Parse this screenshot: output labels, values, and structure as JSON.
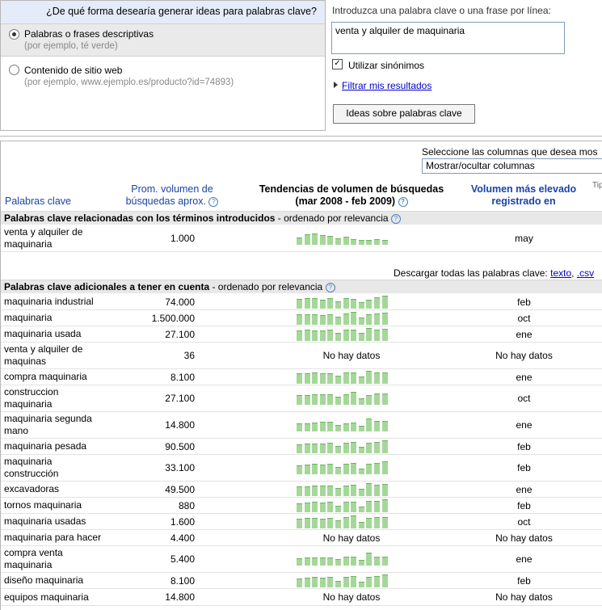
{
  "question": "¿De qué forma desearía generar ideas para palabras clave?",
  "options": [
    {
      "label": "Palabras o frases descriptivas",
      "hint": "(por ejemplo, té verde)",
      "selected": true
    },
    {
      "label": "Contenido de sitio web",
      "hint": "(por ejemplo, www.ejemplo.es/producto?id=74893)",
      "selected": false
    }
  ],
  "keyword_entry": {
    "heading": "Introduzca una palabra clave o una frase por línea:",
    "value": "venta y alquiler de maquinaria"
  },
  "synonyms": {
    "label": "Utilizar sinónimos",
    "checked": true,
    "check_glyph": "✓"
  },
  "filter_link": "Filtrar mis resultados",
  "ideas_button": "Ideas sobre palabras clave",
  "columns": {
    "label": "Seleccione las columnas que desea mos",
    "select_value": "Mostrar/ocultar columnas"
  },
  "tip_text": "Tip",
  "headers": {
    "keyword": "Palabras clave",
    "volume_line1": "Prom. volumen de",
    "volume_line2": "búsquedas aprox.",
    "trend_line1": "Tendencias de volumen de búsquedas",
    "trend_line2": "(mar 2008 - feb 2009)",
    "peak_line1": "Volumen más elevado",
    "peak_line2": "registrado en",
    "help_glyph": "?"
  },
  "section1": {
    "title": "Palabras clave relacionadas con los términos introducidos",
    "suffix": " - ordenado por relevancia"
  },
  "download": {
    "label": "Descargar todas las palabras clave: ",
    "link1": "texto",
    "sep": ", ",
    "link2": ".csv"
  },
  "section2": {
    "title": "Palabras clave adicionales a tener en cuenta",
    "suffix": " - ordenado por relevancia"
  },
  "no_data": "No hay datos",
  "rows1": [
    {
      "keyword": "venta y alquiler de maquinaria",
      "volume": "1.000",
      "peak": "may",
      "trend": [
        0.55,
        0.8,
        0.9,
        0.75,
        0.7,
        0.5,
        0.6,
        0.45,
        0.35,
        0.4,
        0.45,
        0.4
      ]
    }
  ],
  "rows2": [
    {
      "keyword": "maquinaria industrial",
      "volume": "74.000",
      "peak": "feb",
      "trend": [
        0.75,
        0.8,
        0.8,
        0.7,
        0.8,
        0.55,
        0.8,
        0.75,
        0.5,
        0.7,
        0.9,
        1.0
      ]
    },
    {
      "keyword": "maquinaria",
      "volume": "1.500.000",
      "peak": "oct",
      "trend": [
        0.8,
        0.8,
        0.8,
        0.75,
        0.8,
        0.6,
        0.85,
        1.0,
        0.55,
        0.8,
        0.9,
        0.95
      ]
    },
    {
      "keyword": "maquinaria usada",
      "volume": "27.100",
      "peak": "ene",
      "trend": [
        0.8,
        0.85,
        0.8,
        0.8,
        0.85,
        0.65,
        0.85,
        0.85,
        0.6,
        1.0,
        0.9,
        0.95
      ]
    },
    {
      "keyword": "venta y alquiler de maquinas",
      "volume": "36",
      "peak": null,
      "trend": null
    },
    {
      "keyword": "compra maquinaria",
      "volume": "8.100",
      "peak": "ene",
      "trend": [
        0.8,
        0.8,
        0.85,
        0.8,
        0.8,
        0.6,
        0.85,
        0.85,
        0.55,
        1.0,
        0.9,
        0.9
      ]
    },
    {
      "keyword": "construccion maquinaria",
      "volume": "27.100",
      "peak": "oct",
      "trend": [
        0.75,
        0.75,
        0.8,
        0.8,
        0.8,
        0.6,
        0.8,
        1.0,
        0.5,
        0.75,
        0.85,
        0.9
      ]
    },
    {
      "keyword": "maquinaria segunda mano",
      "volume": "14.800",
      "peak": "ene",
      "trend": [
        0.6,
        0.6,
        0.7,
        0.75,
        0.75,
        0.5,
        0.65,
        0.7,
        0.45,
        1.0,
        0.8,
        0.8
      ]
    },
    {
      "keyword": "maquinaria pesada",
      "volume": "90.500",
      "peak": "feb",
      "trend": [
        0.7,
        0.75,
        0.75,
        0.75,
        0.8,
        0.55,
        0.8,
        0.85,
        0.5,
        0.8,
        0.9,
        1.0
      ]
    },
    {
      "keyword": "maquinaria construcción",
      "volume": "33.100",
      "peak": "feb",
      "trend": [
        0.7,
        0.75,
        0.8,
        0.75,
        0.8,
        0.55,
        0.8,
        0.85,
        0.45,
        0.8,
        0.9,
        1.0
      ]
    },
    {
      "keyword": "excavadoras",
      "volume": "49.500",
      "peak": "ene",
      "trend": [
        0.75,
        0.75,
        0.8,
        0.8,
        0.8,
        0.6,
        0.8,
        0.85,
        0.55,
        1.0,
        0.9,
        0.95
      ]
    },
    {
      "keyword": "tornos maquinaria",
      "volume": "880",
      "peak": "feb",
      "trend": [
        0.7,
        0.75,
        0.8,
        0.75,
        0.8,
        0.5,
        0.8,
        0.8,
        0.45,
        0.85,
        0.9,
        1.0
      ]
    },
    {
      "keyword": "maquinaria usadas",
      "volume": "1.600",
      "peak": "oct",
      "trend": [
        0.75,
        0.8,
        0.8,
        0.75,
        0.8,
        0.6,
        0.85,
        1.0,
        0.5,
        0.8,
        0.85,
        0.9
      ]
    },
    {
      "keyword": "maquinaria para hacer",
      "volume": "4.400",
      "peak": null,
      "trend": null
    },
    {
      "keyword": "compra venta maquinaria",
      "volume": "5.400",
      "peak": "ene",
      "trend": [
        0.55,
        0.6,
        0.65,
        0.65,
        0.65,
        0.5,
        0.7,
        0.7,
        0.45,
        1.0,
        0.7,
        0.7
      ]
    },
    {
      "keyword": "diseño maquinaria",
      "volume": "8.100",
      "peak": "feb",
      "trend": [
        0.7,
        0.75,
        0.8,
        0.75,
        0.8,
        0.5,
        0.8,
        0.85,
        0.45,
        0.8,
        0.9,
        1.0
      ]
    },
    {
      "keyword": "equipos maquinaria",
      "volume": "14.800",
      "peak": null,
      "trend": null
    }
  ]
}
